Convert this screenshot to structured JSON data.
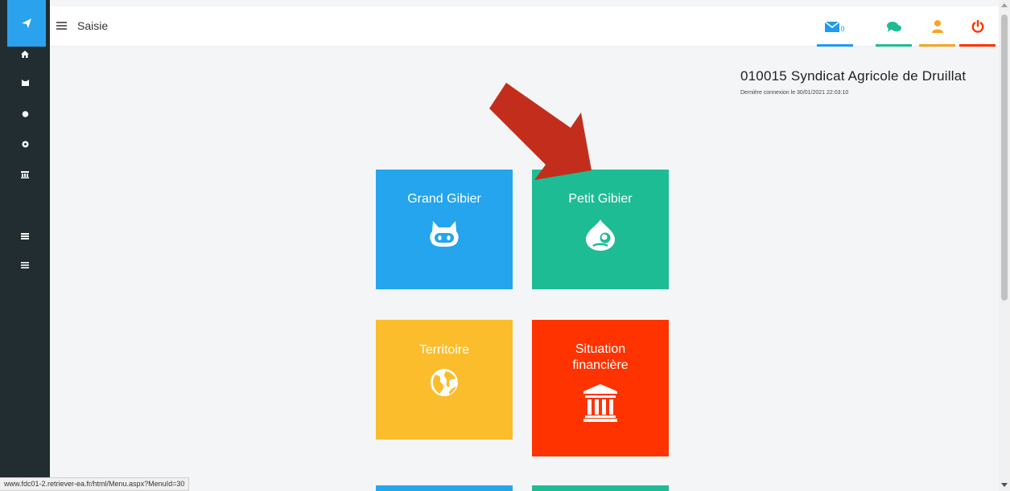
{
  "topbar": {
    "page_title": "Saisie",
    "mail_count": "0"
  },
  "header": {
    "org_name": "010015 Syndicat Agricole de Druillat",
    "last_login": "Dernière connexion le 30/01/2021 22:03:10"
  },
  "tiles": [
    {
      "label": "Grand Gibier",
      "color": "#24a5ee",
      "icon": "github-cat-icon"
    },
    {
      "label": "Petit Gibier",
      "color": "#1ebc94",
      "icon": "drupal-drop-icon"
    },
    {
      "label": "Territoire",
      "color": "#fbbd2c",
      "icon": "globe-icon"
    },
    {
      "label": "Situation financière",
      "color": "#ff3300",
      "icon": "bank-icon"
    }
  ],
  "statusbar": {
    "url": "www.fdc01-2.retriever-ea.fr/html/Menu.aspx?MenuId=30"
  },
  "colors": {
    "sidebar": "#222d32",
    "accent_blue": "#2aa2ee",
    "arrow": "#c32e1c",
    "topbar_mail": "#1e9af3",
    "topbar_chat": "#1ebc94",
    "topbar_user": "#f5a623",
    "topbar_power": "#ff3300"
  }
}
